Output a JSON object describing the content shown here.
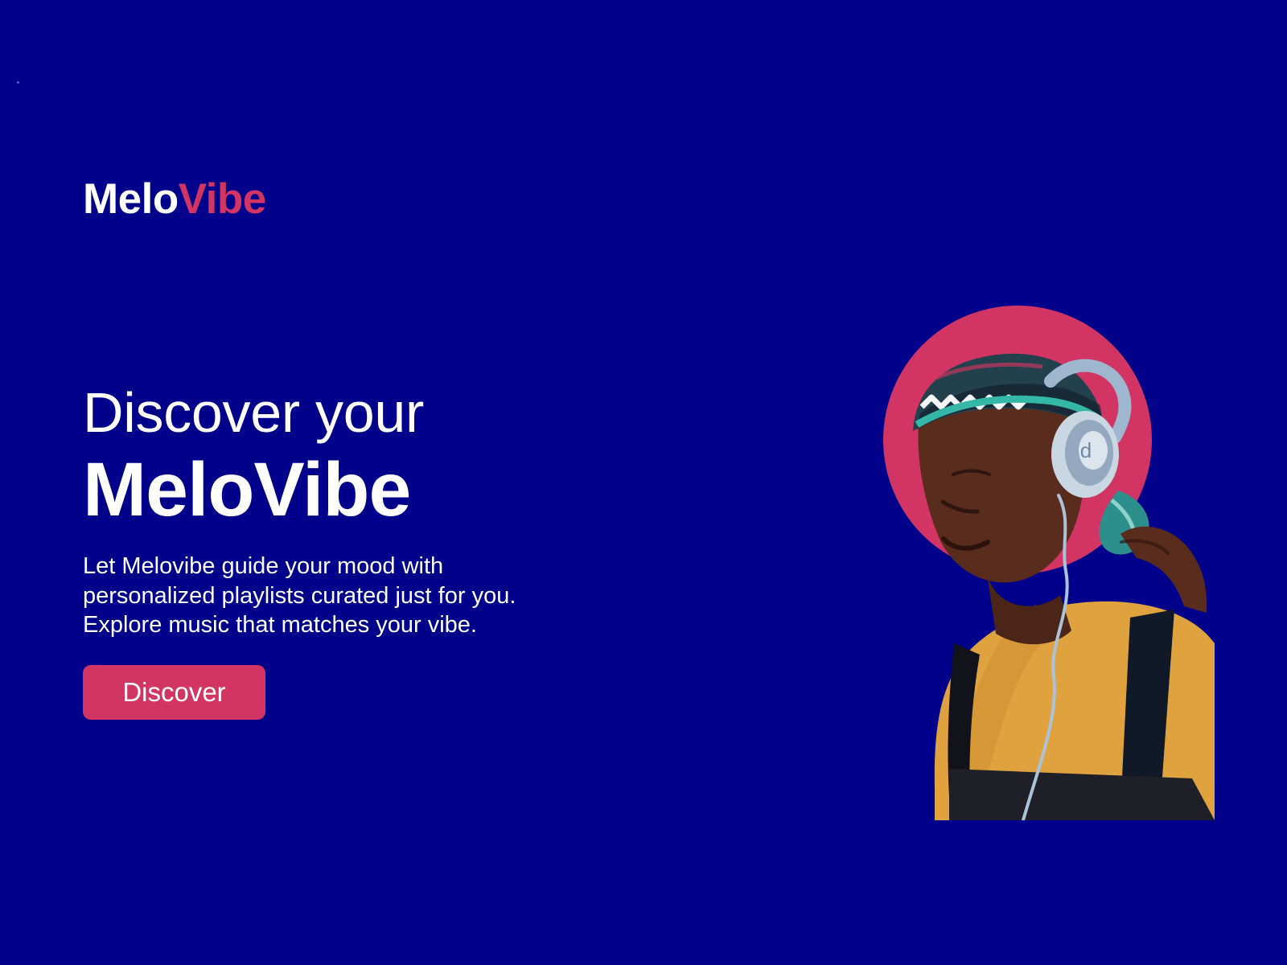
{
  "brand": {
    "logo_part_1": "Melo",
    "logo_part_2": "Vibe",
    "accent_color": "#d23563",
    "background_color": "#00008b"
  },
  "hero": {
    "kicker": "Discover your",
    "title": "MeloVibe",
    "description_lines": [
      "Let Melovibe guide your mood with",
      "personalized playlists curated just for you.",
      "Explore music that matches your vibe."
    ],
    "button_label": "Discover"
  },
  "illustration": {
    "subject": "person-with-headphones",
    "headphone_icon_letter": "d"
  }
}
